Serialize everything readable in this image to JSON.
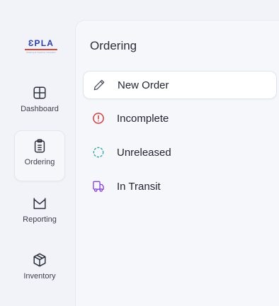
{
  "logo": {
    "text": "ƐPLA",
    "tagline": "Ordering & Inventory Innovation"
  },
  "sidebar": {
    "items": [
      {
        "label": "Dashboard",
        "icon": "dashboard-icon"
      },
      {
        "label": "Ordering",
        "icon": "clipboard-icon",
        "active": true
      },
      {
        "label": "Reporting",
        "icon": "chart-icon"
      },
      {
        "label": "Inventory",
        "icon": "box-icon"
      }
    ]
  },
  "panel": {
    "title": "Ordering",
    "items": [
      {
        "label": "New Order",
        "icon": "pencil-icon",
        "color": "#4a4f5c",
        "active": true
      },
      {
        "label": "Incomplete",
        "icon": "alert-circle-icon",
        "color": "#d23c3c"
      },
      {
        "label": "Unreleased",
        "icon": "dashed-circle-icon",
        "color": "#2aa6a0"
      },
      {
        "label": "In Transit",
        "icon": "truck-icon",
        "color": "#8a3fd6"
      }
    ]
  },
  "colors": {
    "accent": "#2b3da8",
    "background": "#f1f3f8",
    "panel": "#f6f7fa"
  }
}
